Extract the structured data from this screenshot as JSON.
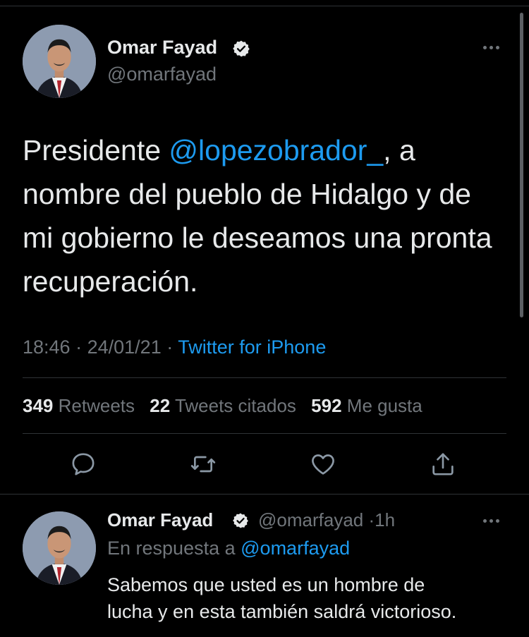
{
  "tweet": {
    "author_name": "Omar Fayad",
    "author_handle": "@omarfayad",
    "text_lines": [
      {
        "before": "Presidente ",
        "mention": "@lopezobrador_",
        "after": ", a"
      },
      "nombre del pueblo de Hidalgo y de",
      "mi gobierno le deseamos una pronta",
      "recuperación."
    ],
    "time": "18:46",
    "date": "24/01/21",
    "separator": "·",
    "source": "Twitter for iPhone",
    "stats": {
      "retweets_count": "349",
      "retweets_label": "Retweets",
      "quotes_count": "22",
      "quotes_label": "Tweets citados",
      "likes_count": "592",
      "likes_label": "Me gusta"
    }
  },
  "reply": {
    "author_name": "Omar Fayad",
    "author_handle": "@omarfayad",
    "time_ago": "1h",
    "in_reply_prefix": "En respuesta a",
    "in_reply_to": "@omarfayad",
    "text_lines": [
      "Sabemos que usted es un hombre de",
      "lucha y en esta también saldrá victorioso."
    ]
  },
  "icons": {
    "verified": "verified-badge-icon",
    "more": "more-options-icon",
    "reply": "reply-icon",
    "retweet": "retweet-icon",
    "like": "heart-icon",
    "share": "share-icon"
  },
  "colors": {
    "background": "#000000",
    "text": "#e7e9ea",
    "secondary": "#71767b",
    "accent": "#1d9bf0",
    "divider": "#2f3336"
  }
}
